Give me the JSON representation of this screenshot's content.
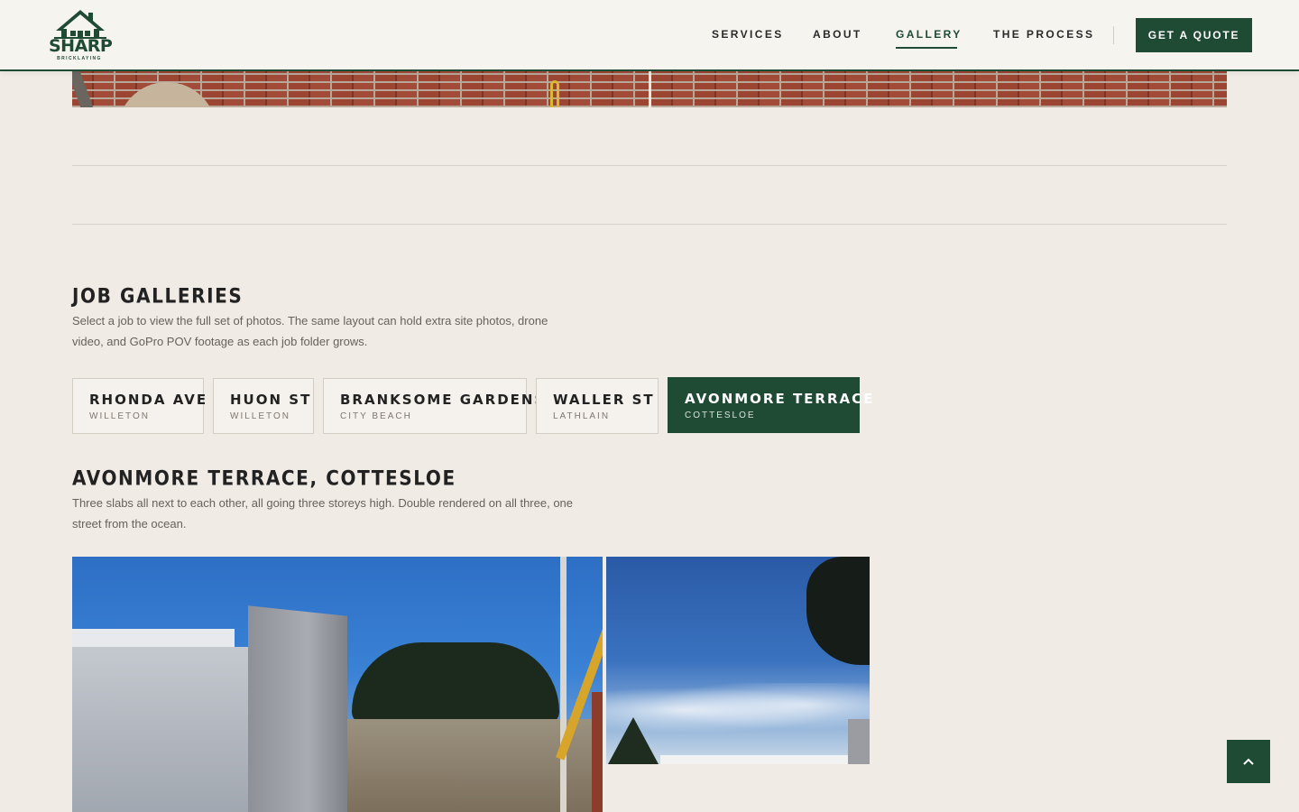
{
  "brand": {
    "name": "SHARP",
    "tagline": "BRICKLAYING",
    "color": "#1f4a34"
  },
  "nav": {
    "items": [
      {
        "label": "SERVICES",
        "active": false
      },
      {
        "label": "ABOUT",
        "active": false
      },
      {
        "label": "GALLERY",
        "active": true
      },
      {
        "label": "THE PROCESS",
        "active": false
      }
    ],
    "cta": "GET A QUOTE"
  },
  "galleries": {
    "title": "JOB GALLERIES",
    "intro_line1": "Select a job to view the full set of photos. The same layout can hold extra site photos, drone",
    "intro_line2": "video, and GoPro POV footage as each job folder grows.",
    "jobs": [
      {
        "name": "RHONDA AVE",
        "suburb": "WILLETON",
        "active": false
      },
      {
        "name": "HUON ST",
        "suburb": "WILLETON",
        "active": false
      },
      {
        "name": "BRANKSOME GARDENS",
        "suburb": "CITY BEACH",
        "active": false
      },
      {
        "name": "WALLER ST",
        "suburb": "LATHLAIN",
        "active": false
      },
      {
        "name": "AVONMORE TERRACE",
        "suburb": "COTTESLOE",
        "active": true
      }
    ]
  },
  "selected_job": {
    "title": "AVONMORE TERRACE, COTTESLOE",
    "description_line1": "Three slabs all next to each other, all going three storeys high. Double rendered on all three, one",
    "description_line2": "street from the ocean."
  },
  "icons": {
    "logo": "house-logo-icon",
    "back_to_top": "chevron-up-icon"
  }
}
